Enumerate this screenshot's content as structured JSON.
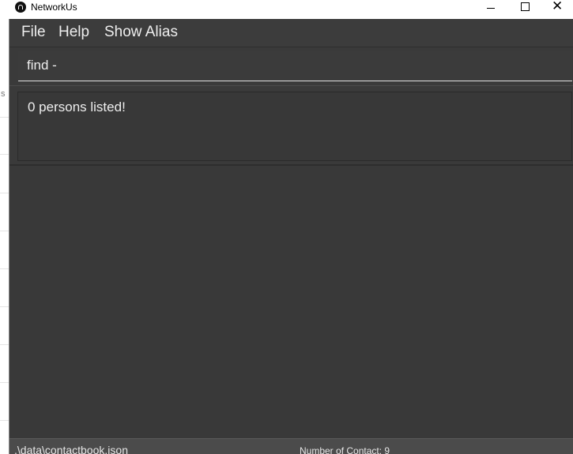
{
  "window": {
    "title": "NetworkUs",
    "logo_icon": "networkus-logo-icon",
    "controls": [
      "minimize-icon",
      "maximize-icon",
      "close-icon"
    ]
  },
  "background_window": {
    "partial_text": "s"
  },
  "menu": {
    "file": "File",
    "help": "Help",
    "show_alias": "Show Alias"
  },
  "command_box": {
    "value": "find -"
  },
  "result_display": {
    "message": "0 persons listed!"
  },
  "status_bar": {
    "save_location": ".\\data\\contactbook.json",
    "contact_count": "Number of Contact: 9"
  },
  "colors": {
    "background": "#3a3a3a",
    "text": "#eeeeee",
    "status_bar": "#4b4b4b"
  }
}
